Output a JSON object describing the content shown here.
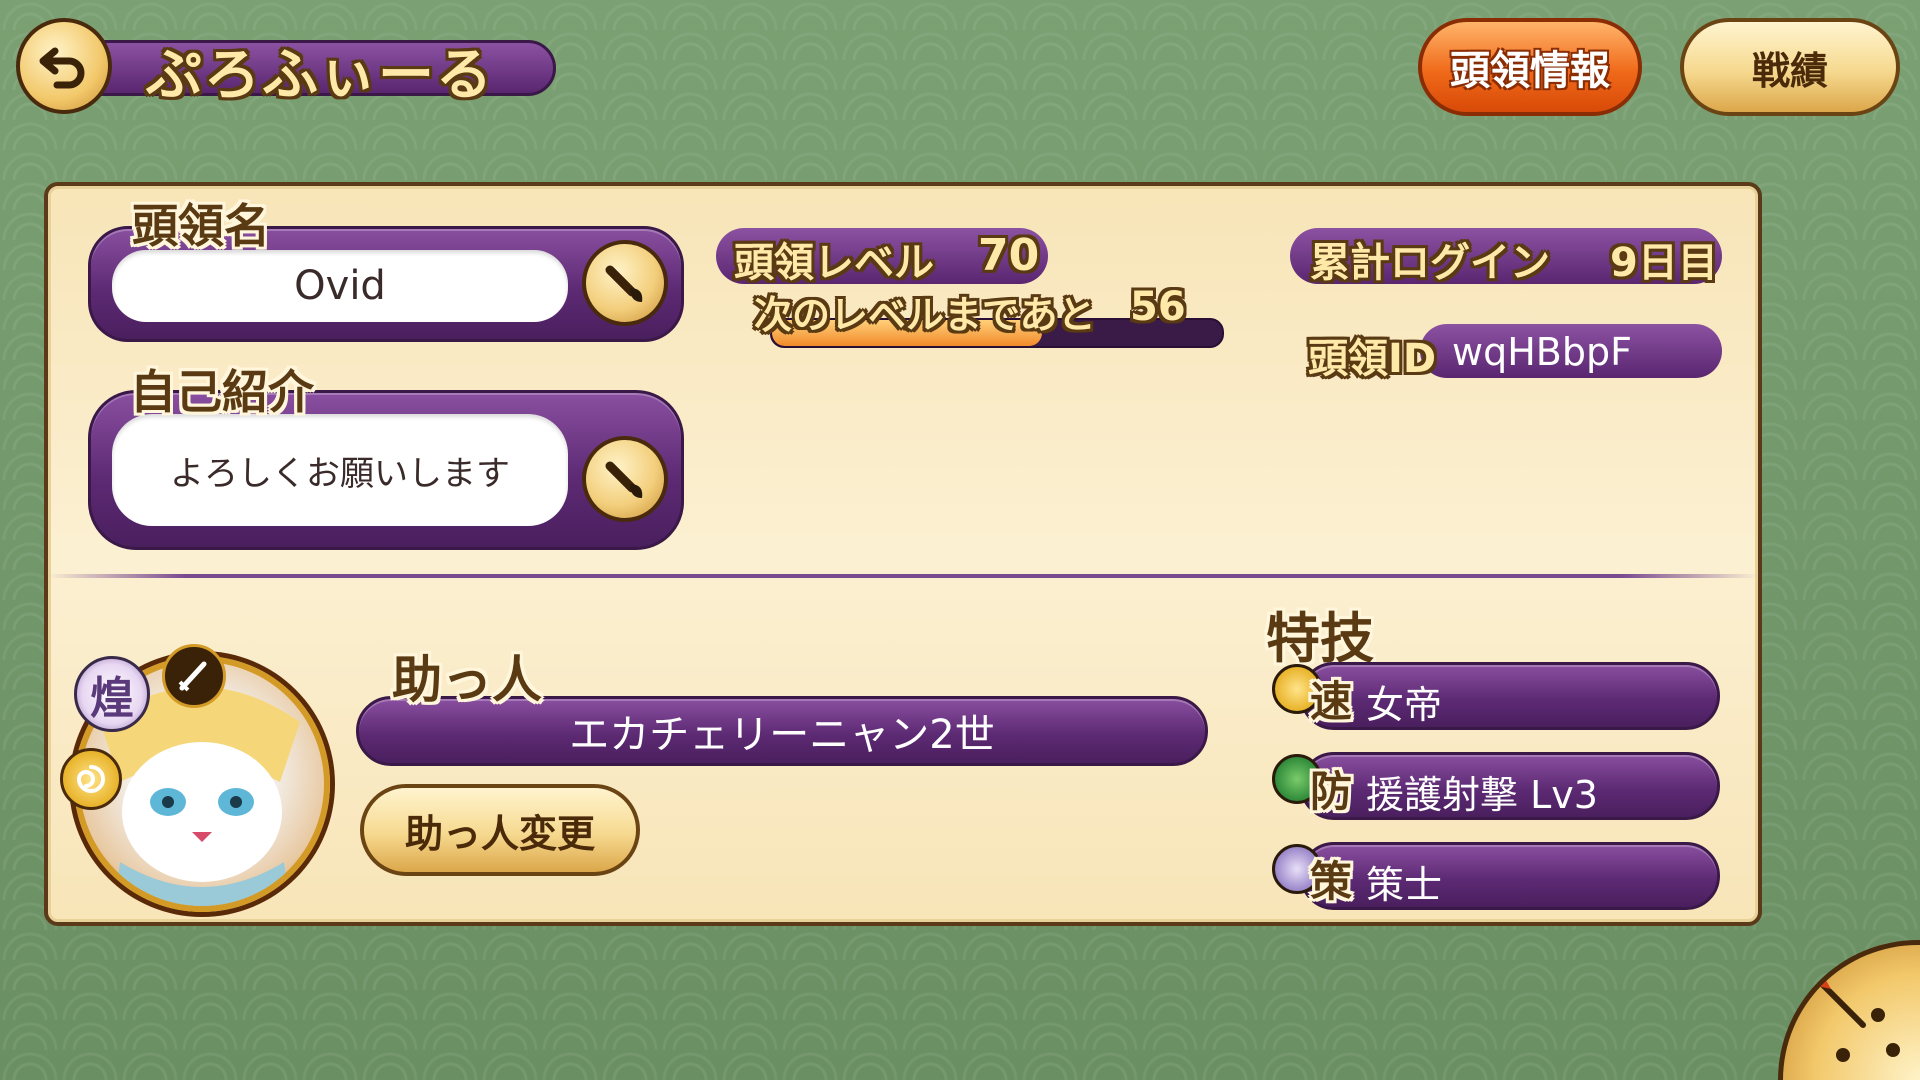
{
  "header": {
    "title": "ぷろふぃーる",
    "tab_leader_info": "頭領情報",
    "tab_record": "戦績"
  },
  "profile": {
    "name_label": "頭領名",
    "name_value": "Ovid",
    "intro_label": "自己紹介",
    "intro_value": "よろしくお願いします",
    "level_label": "頭領レベル",
    "level_value": "70",
    "next_level_label": "次のレベルまであと",
    "next_level_value": "56",
    "exp_progress_percent": 60,
    "login_label": "累計ログイン",
    "login_value": "9日目",
    "id_label": "頭領ID",
    "id_value": "wqHBbpF"
  },
  "helper": {
    "label": "助っ人",
    "name": "エカチェリーニャン2世",
    "change_button": "助っ人変更",
    "rarity_badge": "煌"
  },
  "skills": {
    "label": "特技",
    "items": [
      {
        "type": "速",
        "name": "女帝",
        "color": "#e8b32a",
        "icon": "swirl-icon"
      },
      {
        "type": "防",
        "name": "援護射撃 Lv3",
        "color": "#2f8a3a",
        "icon": "grass-icon"
      },
      {
        "type": "策",
        "name": "策士",
        "color": "#9a86c9",
        "icon": "moon-icon"
      }
    ]
  },
  "colors": {
    "accent_purple": "#5d2a74",
    "panel_cream": "#fbecc6",
    "active_tab": "#f06a1a"
  }
}
